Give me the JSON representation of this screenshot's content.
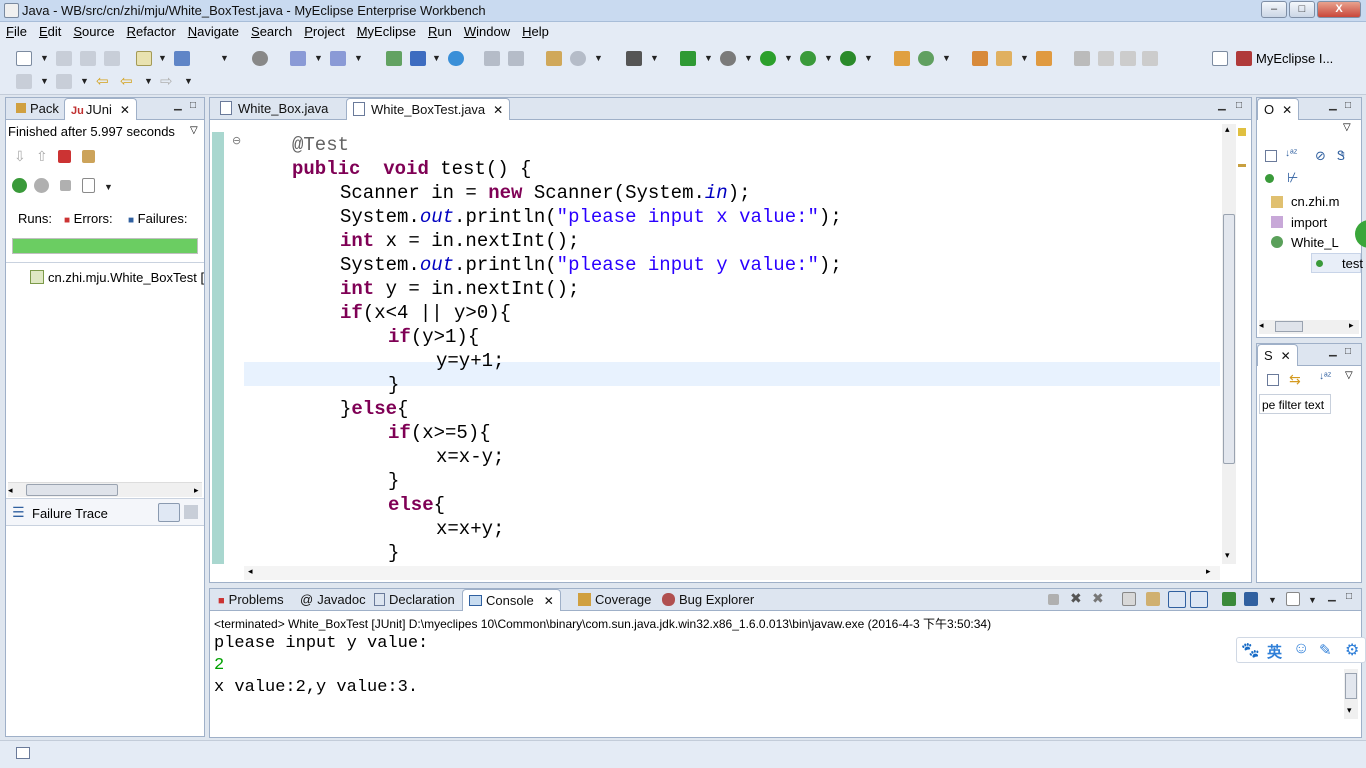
{
  "window": {
    "title": "Java - WB/src/cn/zhi/mju/White_BoxTest.java - MyEclipse Enterprise Workbench",
    "minimize": "–",
    "maximize": "□",
    "close": "X"
  },
  "menu": [
    "File",
    "Edit",
    "Source",
    "Refactor",
    "Navigate",
    "Search",
    "Project",
    "MyEclipse",
    "Run",
    "Window",
    "Help"
  ],
  "perspective": {
    "label": "MyEclipse I..."
  },
  "left_panel": {
    "tabs": [
      "Pack",
      "JUni"
    ],
    "status": "Finished after 5.997 seconds",
    "runs_label": "Runs:",
    "errors_label": "Errors:",
    "failures_label": "Failures:",
    "progress": 1.0,
    "tree_item": "cn.zhi.mju.White_BoxTest [",
    "failure_trace": "Failure Trace"
  },
  "editor": {
    "tabs": [
      "White_Box.java",
      "White_BoxTest.java"
    ],
    "active_tab": 1,
    "lines": [
      {
        "indent": 0,
        "parts": [
          [
            "ann",
            "@Test"
          ]
        ]
      },
      {
        "indent": 0,
        "parts": [
          [
            "kw",
            "public"
          ],
          [
            "",
            "  "
          ],
          [
            "kw",
            "void"
          ],
          [
            "",
            " test() {"
          ]
        ]
      },
      {
        "indent": 1,
        "parts": [
          [
            "",
            "Scanner in = "
          ],
          [
            "kw",
            "new"
          ],
          [
            "",
            " Scanner(System."
          ],
          [
            "fld",
            "in"
          ],
          [
            "",
            ");"
          ]
        ]
      },
      {
        "indent": 1,
        "parts": [
          [
            "",
            "System."
          ],
          [
            "fld",
            "out"
          ],
          [
            "",
            ".println("
          ],
          [
            "str",
            "\"please input x value:\""
          ],
          [
            "",
            ");"
          ]
        ]
      },
      {
        "indent": 1,
        "parts": [
          [
            "kw",
            "int"
          ],
          [
            "",
            " x = in.nextInt();"
          ]
        ]
      },
      {
        "indent": 1,
        "parts": [
          [
            "",
            "System."
          ],
          [
            "fld",
            "out"
          ],
          [
            "",
            ".println("
          ],
          [
            "str",
            "\"please input y value:\""
          ],
          [
            "",
            ");"
          ]
        ]
      },
      {
        "indent": 1,
        "parts": [
          [
            "kw",
            "int"
          ],
          [
            "",
            " y = in.nextInt();"
          ]
        ]
      },
      {
        "indent": 1,
        "parts": [
          [
            "kw",
            "if"
          ],
          [
            "",
            "(x<4 || y>0){"
          ]
        ]
      },
      {
        "indent": 2,
        "parts": [
          [
            "kw",
            "if"
          ],
          [
            "",
            "(y>1){"
          ]
        ]
      },
      {
        "indent": 3,
        "parts": [
          [
            "",
            "y=y+1;"
          ]
        ]
      },
      {
        "indent": 2,
        "parts": [
          [
            "",
            "}"
          ]
        ]
      },
      {
        "indent": 1,
        "parts": [
          [
            "",
            "}"
          ],
          [
            "kw",
            "else"
          ],
          [
            "",
            "{"
          ]
        ]
      },
      {
        "indent": 2,
        "parts": [
          [
            "kw",
            "if"
          ],
          [
            "",
            "(x>=5){"
          ]
        ]
      },
      {
        "indent": 3,
        "parts": [
          [
            "",
            "x=x-y;"
          ]
        ]
      },
      {
        "indent": 2,
        "parts": [
          [
            "",
            "}"
          ]
        ]
      },
      {
        "indent": 2,
        "parts": [
          [
            "kw",
            "else"
          ],
          [
            "",
            "{"
          ]
        ]
      },
      {
        "indent": 3,
        "parts": [
          [
            "",
            "x=x+y;"
          ]
        ]
      },
      {
        "indent": 2,
        "parts": [
          [
            "",
            "}"
          ]
        ]
      }
    ]
  },
  "outline_panel": {
    "tab": "O",
    "items": [
      "cn.zhi.m",
      "import",
      "White_L",
      "test"
    ]
  },
  "search_panel": {
    "tab": "S",
    "filter_placeholder": "pe filter text"
  },
  "bottom_panel": {
    "tabs": [
      "Problems",
      "Javadoc",
      "Declaration",
      "Console",
      "Coverage",
      "Bug Explorer"
    ],
    "active_tab": 3,
    "header": "<terminated> White_BoxTest [JUnit] D:\\myeclipes 10\\Common\\binary\\com.sun.java.jdk.win32.x86_1.6.0.013\\bin\\javaw.exe (2016-4-3 下午3:50:34)",
    "lines": [
      "please input y value:",
      "2",
      "x value:2,y value:3."
    ]
  },
  "ime": {
    "label": "英"
  },
  "colors": {
    "accent": "#6bcd62",
    "keyword": "#7f0055",
    "string": "#2a00ff",
    "field": "#0000c0",
    "input": "#00a000"
  }
}
